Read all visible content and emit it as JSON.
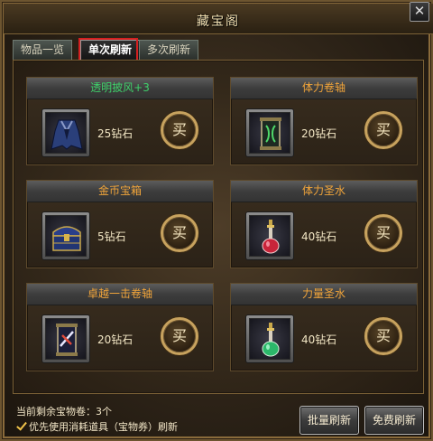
{
  "window": {
    "title": "藏宝阁",
    "close_glyph": "✕"
  },
  "tabs": [
    {
      "label": "物品一览",
      "active": false
    },
    {
      "label": "单次刷新",
      "active": true
    },
    {
      "label": "多次刷新",
      "active": false
    }
  ],
  "items": [
    {
      "name": "透明披风+3",
      "name_color": "green",
      "price": "25钻石",
      "icon": "cloak-icon",
      "buy_label": "买"
    },
    {
      "name": "体力卷轴",
      "name_color": "orange",
      "price": "20钻石",
      "icon": "scroll-icon",
      "buy_label": "买"
    },
    {
      "name": "金币宝箱",
      "name_color": "orange",
      "price": "5钻石",
      "icon": "treasure-chest-icon",
      "buy_label": "买"
    },
    {
      "name": "体力圣水",
      "name_color": "orange",
      "price": "40钻石",
      "icon": "red-potion-icon",
      "buy_label": "买"
    },
    {
      "name": "卓越一击卷轴",
      "name_color": "orange",
      "price": "20钻石",
      "icon": "strike-scroll-icon",
      "buy_label": "买"
    },
    {
      "name": "力量圣水",
      "name_color": "orange",
      "price": "40钻石",
      "icon": "green-potion-icon",
      "buy_label": "买"
    }
  ],
  "footer": {
    "remaining_text": "当前剩余宝物卷：3个",
    "use_item_checkbox_label": "优先使用消耗道具（宝物券）刷新",
    "use_item_checked": true,
    "batch_refresh_label": "批量刷新",
    "free_refresh_label": "免费刷新"
  },
  "colors": {
    "name_green": "#3fd06a",
    "name_orange": "#f0a43a",
    "tab_highlight": "#d42020"
  }
}
